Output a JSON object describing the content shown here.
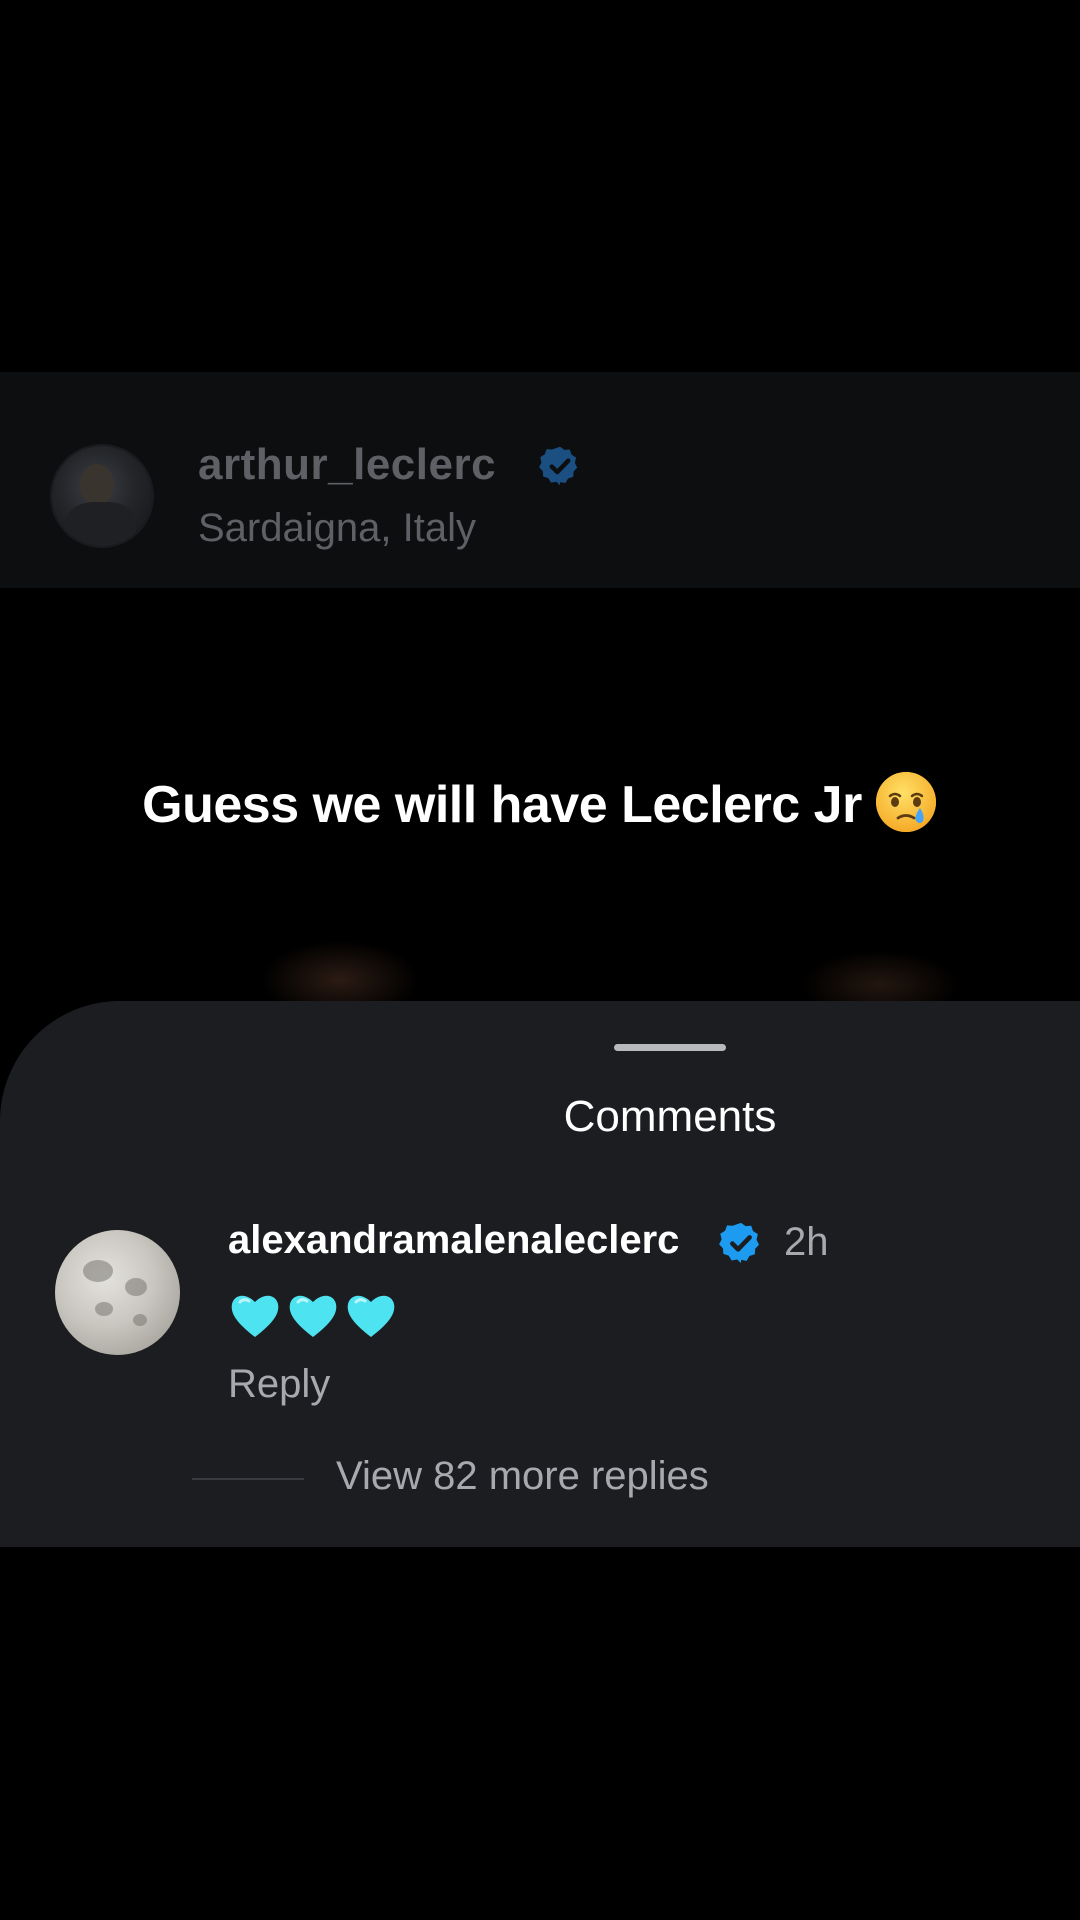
{
  "post": {
    "username": "arthur_leclerc",
    "location": "Sardaigna, Italy",
    "caption": "Guess we will have Leclerc Jr",
    "caption_emoji": "face-holding-back-tears-icon"
  },
  "comments_sheet": {
    "title": "Comments",
    "comment": {
      "username": "alexandramalenaleclerc",
      "time": "2h",
      "text_emojis": [
        "light-blue-heart-icon",
        "light-blue-heart-icon",
        "light-blue-heart-icon"
      ],
      "reply_label": "Reply",
      "view_replies_label": "View 82 more replies"
    }
  },
  "colors": {
    "background": "#000000",
    "sheet": "#1c1d21",
    "verified_blue": "#1d9bf0",
    "heart_cyan": "#4de3f0",
    "secondary_text": "#a8a9ae"
  }
}
